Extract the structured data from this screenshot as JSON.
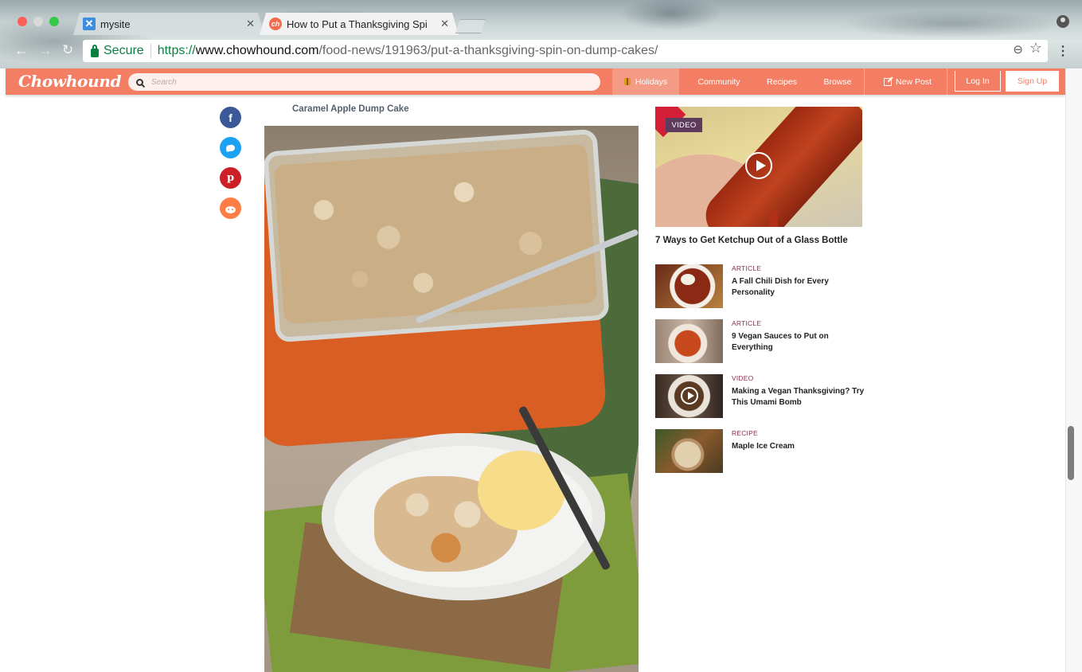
{
  "browser": {
    "tabs": [
      {
        "title": "mysite",
        "active": false
      },
      {
        "title": "How to Put a Thanksgiving Spi",
        "active": true
      }
    ],
    "secure_label": "Secure",
    "url": {
      "scheme": "https://",
      "host": "www.chowhound.com",
      "path": "/food-news/191963/put-a-thanksgiving-spin-on-dump-cakes/"
    }
  },
  "header": {
    "logo": "Chowhound",
    "search_placeholder": "Search",
    "nav": {
      "holidays": "Holidays",
      "community": "Community",
      "recipes": "Recipes",
      "browse": "Browse",
      "new_post": "New Post",
      "log_in": "Log In",
      "sign_up": "Sign Up"
    },
    "accent_color": "#f47e63"
  },
  "article": {
    "image_caption": "Caramel Apple Dump Cake"
  },
  "share": [
    "facebook-icon",
    "twitter-icon",
    "pinterest-icon",
    "reddit-icon"
  ],
  "sidebar": {
    "featured": {
      "badge": "VIDEO",
      "title": "7 Ways to Get Ketchup Out of a Glass Bottle"
    },
    "cards": [
      {
        "type": "ARTICLE",
        "title": "A Fall Chili Dish for Every Personality"
      },
      {
        "type": "ARTICLE",
        "title": "9 Vegan Sauces to Put on Everything"
      },
      {
        "type": "VIDEO",
        "title": "Making a Vegan Thanksgiving? Try This Umami Bomb"
      },
      {
        "type": "RECIPE",
        "title": "Maple Ice Cream"
      }
    ]
  }
}
